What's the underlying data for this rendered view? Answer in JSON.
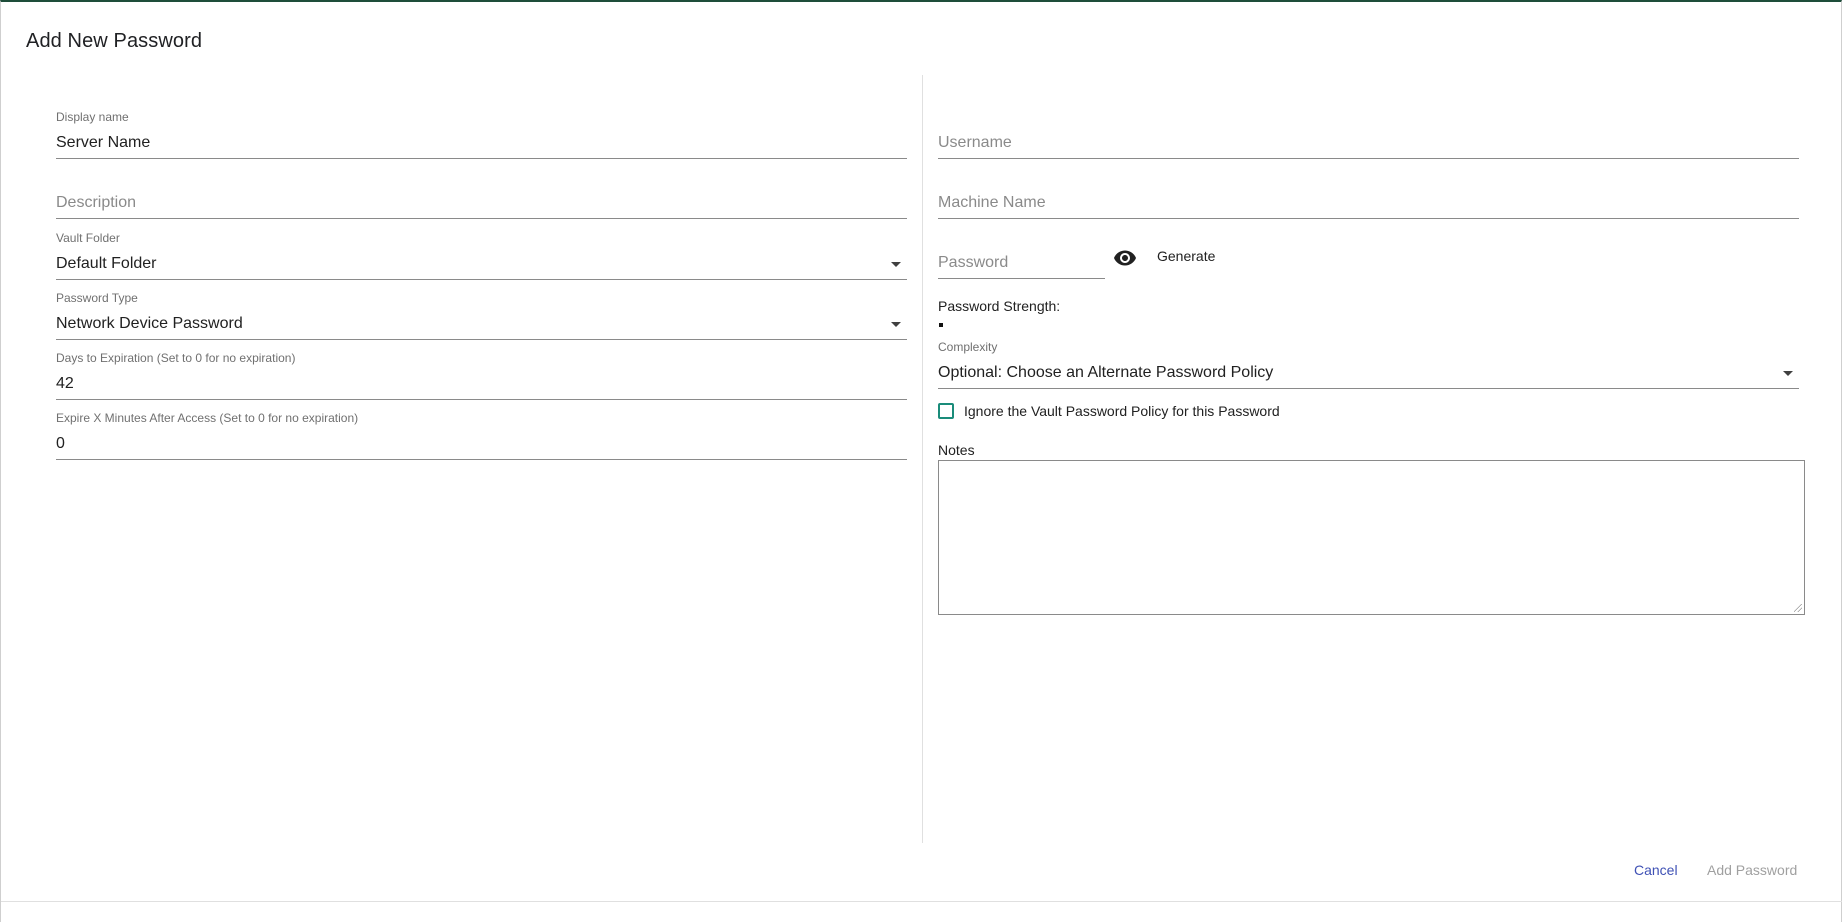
{
  "dialog": {
    "title": "Add New Password"
  },
  "left": {
    "display_name": {
      "label": "Display name",
      "value": "Server Name"
    },
    "description": {
      "placeholder": "Description"
    },
    "vault_folder": {
      "label": "Vault Folder",
      "value": "Default Folder"
    },
    "password_type": {
      "label": "Password Type",
      "value": "Network Device Password"
    },
    "days_to_expiration": {
      "label": "Days to Expiration (Set to 0 for no expiration)",
      "value": "42"
    },
    "expire_minutes": {
      "label": "Expire X Minutes After Access (Set to 0 for no expiration)",
      "value": "0"
    }
  },
  "right": {
    "username": {
      "placeholder": "Username"
    },
    "machine_name": {
      "placeholder": "Machine Name"
    },
    "password": {
      "placeholder": "Password",
      "toggle_icon": "eye-icon",
      "generate_label": "Generate"
    },
    "strength": {
      "label": "Password Strength:"
    },
    "complexity": {
      "label": "Complexity",
      "value": "Optional: Choose an Alternate Password Policy"
    },
    "ignore_policy": {
      "label": "Ignore the Vault Password Policy for this Password",
      "checked": false
    },
    "notes": {
      "label": "Notes",
      "value": ""
    }
  },
  "actions": {
    "cancel_label": "Cancel",
    "add_label": "Add Password"
  },
  "colors": {
    "accent": "#1a8c7a",
    "link": "#3f51b5",
    "disabled": "#a0a0a0"
  }
}
